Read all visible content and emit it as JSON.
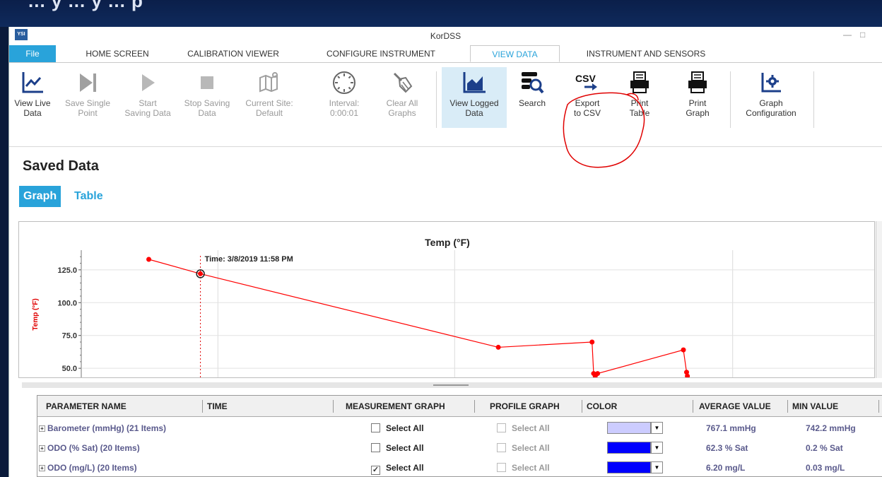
{
  "app": {
    "title": "KorDSS",
    "icon_text": "YSI"
  },
  "overlay_text": "... y ... y ... p",
  "tabs": [
    {
      "label": "File"
    },
    {
      "label": "HOME SCREEN"
    },
    {
      "label": "CALIBRATION VIEWER"
    },
    {
      "label": "CONFIGURE INSTRUMENT"
    },
    {
      "label": "VIEW DATA"
    },
    {
      "label": "INSTRUMENT AND SENSORS"
    }
  ],
  "ribbon": [
    {
      "label": "View Live\nData",
      "icon": "line-chart-icon",
      "state": "enabled"
    },
    {
      "label": "Save Single\nPoint",
      "icon": "step-forward-icon",
      "state": "disabled"
    },
    {
      "label": "Start\nSaving Data",
      "icon": "play-icon",
      "state": "disabled"
    },
    {
      "label": "Stop Saving\nData",
      "icon": "stop-icon",
      "state": "disabled"
    },
    {
      "label": "Current Site:\nDefault",
      "icon": "map-icon",
      "state": "disabled"
    },
    {
      "label": "Interval:\n0:00:01",
      "icon": "timer-icon",
      "state": "disabled"
    },
    {
      "label": "Clear All\nGraphs",
      "icon": "broom-icon",
      "state": "disabled"
    },
    {
      "label": "View Logged\nData",
      "icon": "area-chart-icon",
      "state": "selected"
    },
    {
      "label": "Search",
      "icon": "search-icon",
      "state": "enabled"
    },
    {
      "label": "Export\nto CSV",
      "icon": "csv-export-icon",
      "icon_text": "CSV",
      "state": "enabled"
    },
    {
      "label": "Print\nTable",
      "icon": "printer-icon",
      "state": "enabled"
    },
    {
      "label": "Print\nGraph",
      "icon": "printer-icon",
      "state": "enabled"
    },
    {
      "label": "Graph\nConfiguration",
      "icon": "chart-settings-icon",
      "state": "enabled"
    }
  ],
  "page": {
    "title": "Saved Data",
    "view_tabs": [
      {
        "label": "Graph",
        "active": true
      },
      {
        "label": "Table",
        "active": false
      }
    ]
  },
  "chart_data": {
    "type": "line",
    "title": "Temp (°F)",
    "ylabel": "Temp (°F)",
    "yticks": [
      "125.0",
      "100.0",
      "75.0",
      "50.0"
    ],
    "ylim": [
      42,
      140
    ],
    "series": [
      {
        "color": "#ff0000",
        "points": [
          [
            0.085,
            133
          ],
          [
            0.15,
            122
          ],
          [
            0.525,
            66
          ],
          [
            0.643,
            70
          ],
          [
            0.645,
            46
          ],
          [
            0.647,
            44
          ],
          [
            0.65,
            46
          ],
          [
            0.758,
            64
          ],
          [
            0.762,
            47
          ],
          [
            0.763,
            44
          ]
        ]
      }
    ],
    "cursor": {
      "label": "Time: 3/8/2019 11:58 PM",
      "x": 0.15,
      "y": 122
    }
  },
  "table": {
    "columns": [
      "PARAMETER NAME",
      "TIME",
      "MEASUREMENT GRAPH",
      "PROFILE GRAPH",
      "COLOR",
      "AVERAGE VALUE",
      "MIN VALUE"
    ],
    "rows": [
      {
        "name": "Barometer (mmHg) (21 Items)",
        "measurement": "Select All",
        "measurement_checked": false,
        "profile": "Select All",
        "color": "#ccccff",
        "avg": "767.1 mmHg",
        "min": "742.2 mmHg"
      },
      {
        "name": "ODO (% Sat) (20 Items)",
        "measurement": "Select All",
        "measurement_checked": false,
        "profile": "Select All",
        "color": "#0000ff",
        "avg": "62.3 % Sat",
        "min": "0.2 % Sat"
      },
      {
        "name": "ODO (mg/L) (20 Items)",
        "measurement": "Select All",
        "measurement_checked": true,
        "profile": "Select All",
        "color": "#0000ff",
        "avg": "6.20 mg/L",
        "min": "0.03 mg/L"
      }
    ]
  },
  "colors": {
    "accent": "#29a3da",
    "annotation": "#e00000",
    "series": "#ff0000"
  }
}
